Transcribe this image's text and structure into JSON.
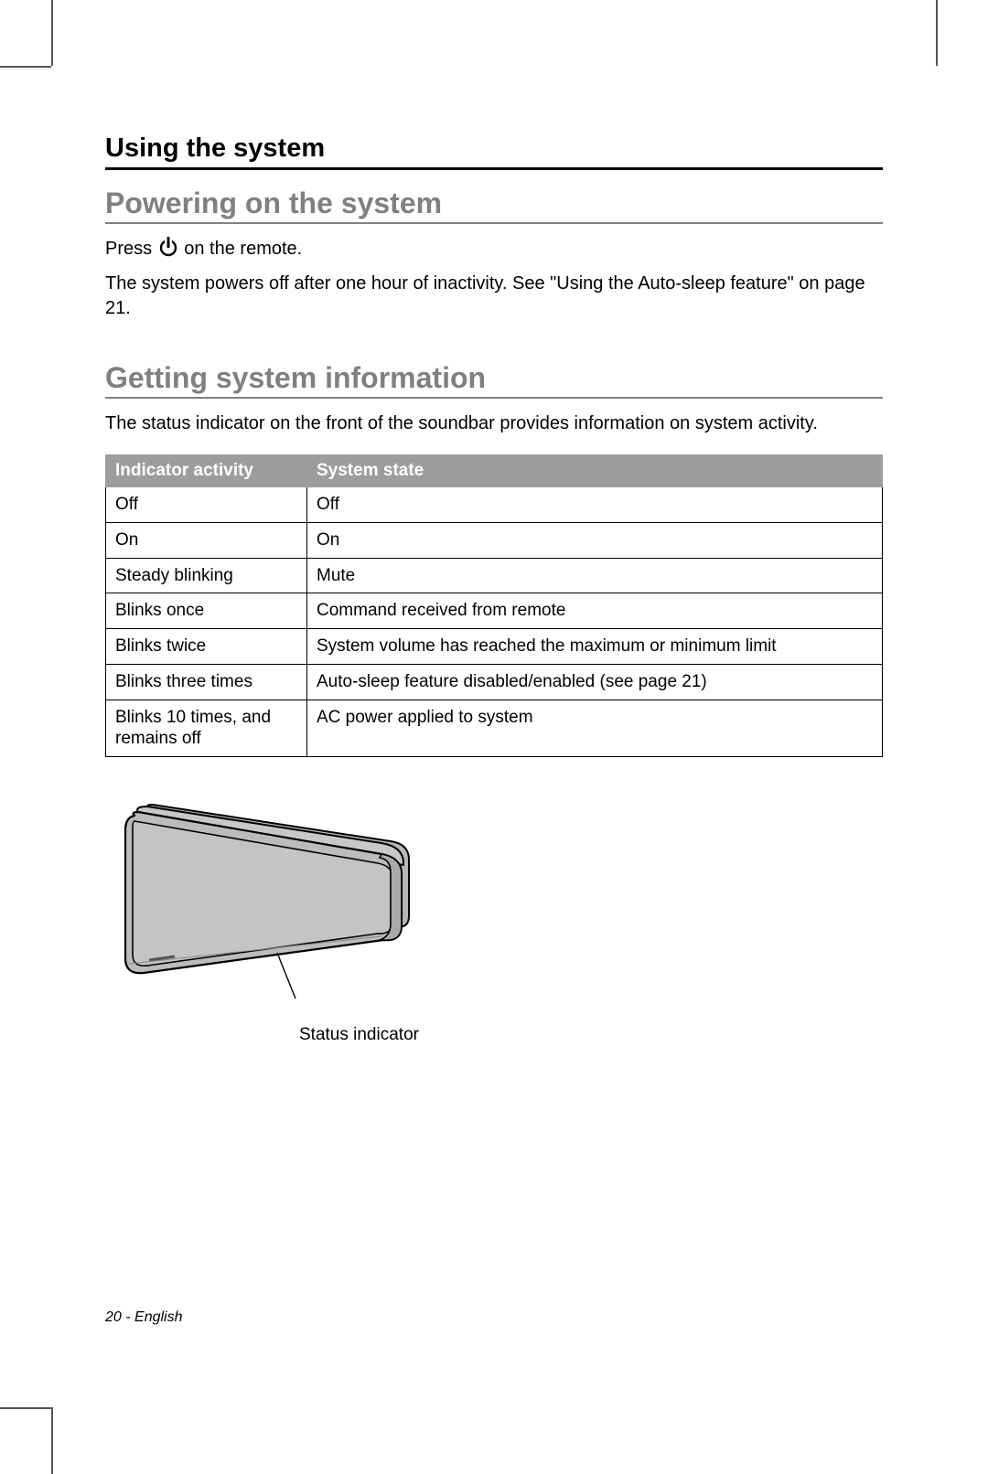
{
  "section_title": "Using the system",
  "sub1": {
    "heading": "Powering on the system",
    "line1_before": "Press ",
    "line1_after": " on the remote.",
    "line2": "The system powers off after one hour of inactivity. See \"Using the Auto-sleep feature\" on page 21."
  },
  "sub2": {
    "heading": "Getting system information",
    "intro": "The status indicator on the front of the soundbar provides information on system activity.",
    "table": {
      "headers": [
        "Indicator activity",
        "System state"
      ],
      "rows": [
        [
          "Off",
          "Off"
        ],
        [
          "On",
          "On"
        ],
        [
          "Steady blinking",
          "Mute"
        ],
        [
          "Blinks once",
          "Command received from remote"
        ],
        [
          "Blinks twice",
          "System volume has reached the maximum or minimum limit"
        ],
        [
          "Blinks three times",
          "Auto-sleep feature disabled/enabled (see page 21)"
        ],
        [
          "Blinks 10 times, and remains off",
          "AC power applied to system"
        ]
      ]
    }
  },
  "diagram_label": "Status indicator",
  "footer": "20 - English"
}
